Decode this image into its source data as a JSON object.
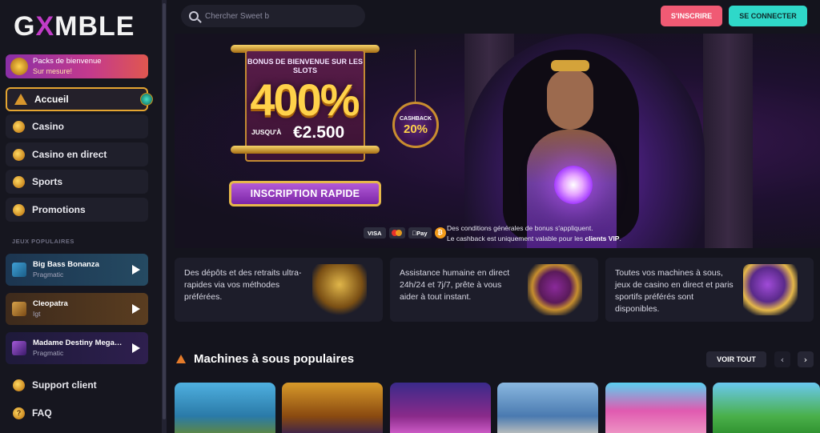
{
  "logo": {
    "prefix": "G",
    "x": "X",
    "suffix": "MBLE"
  },
  "promo": {
    "title": "Packs de bienvenue",
    "subtitle": "Sur mesure!"
  },
  "nav": [
    {
      "label": "Accueil",
      "icon": "pyramid-icon"
    },
    {
      "label": "Casino",
      "icon": "chip-icon"
    },
    {
      "label": "Casino en direct",
      "icon": "dice-icon"
    },
    {
      "label": "Sports",
      "icon": "ball-icon"
    },
    {
      "label": "Promotions",
      "icon": "ankh-icon"
    }
  ],
  "popular_label": "JEUX POPULAIRES",
  "popular_games": [
    {
      "title": "Big Bass Bonanza",
      "provider": "Pragmatic"
    },
    {
      "title": "Cleopatra",
      "provider": "Igt"
    },
    {
      "title": "Madame Destiny Megaw...",
      "provider": "Pragmatic"
    }
  ],
  "footer_nav": [
    {
      "label": "Support client",
      "icon": "headset-icon"
    },
    {
      "label": "FAQ",
      "icon": "question-icon"
    }
  ],
  "search": {
    "placeholder": "Chercher Sweet b"
  },
  "header": {
    "signup": "S'INSCRIRE",
    "login": "SE CONNECTER"
  },
  "hero": {
    "bonus_label": "BONUS DE BIENVENUE SUR LES SLOTS",
    "bonus_percent": "400%",
    "bonus_upto": "JUSQU'À",
    "bonus_amount": "€2.500",
    "cashback_label": "CASHBACK",
    "cashback_percent": "20%",
    "cta": "INSCRIPTION RAPIDE",
    "payments": [
      "VISA",
      "Pay"
    ],
    "terms_line1": "Des conditions générales de bonus s'appliquent.",
    "terms_line2_pre": "Le cashback est uniquement valable pour les ",
    "terms_line2_vip": "clients VIP",
    "terms_line2_post": "."
  },
  "features": [
    {
      "text": "Des dépôts et des retraits ultra-rapides via vos méthodes préférées.",
      "art": "pharaoh-gold-art"
    },
    {
      "text": "Assistance humaine en direct 24h/24 et 7j/7, prête à vous aider à tout instant.",
      "art": "treasure-book-art"
    },
    {
      "text": "Toutes vos machines à sous, jeux de casino en direct et paris sportifs préférés sont disponibles.",
      "art": "cat-dice-art"
    }
  ],
  "slots": {
    "title": "Machines à sous populaires",
    "view_all": "VOIR TOUT",
    "prev": "‹",
    "next": "›"
  },
  "colors": {
    "accent_pink": "#f05a74",
    "accent_teal": "#2fd8c9",
    "gold": "#e4a531",
    "bg": "#14141d"
  }
}
